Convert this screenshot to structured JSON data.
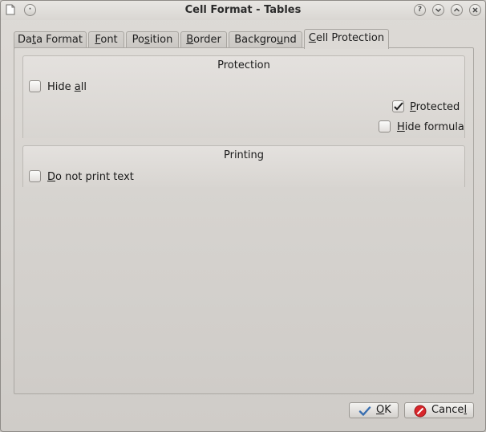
{
  "window": {
    "title": "Cell Format - Tables",
    "controls": [
      "?",
      "v",
      "^",
      "x"
    ]
  },
  "tabs": [
    {
      "pre": "Da",
      "key": "t",
      "post": "a Format",
      "active": false
    },
    {
      "pre": "",
      "key": "F",
      "post": "ont",
      "active": false
    },
    {
      "pre": "Po",
      "key": "s",
      "post": "ition",
      "active": false
    },
    {
      "pre": "",
      "key": "B",
      "post": "order",
      "active": false
    },
    {
      "pre": "Backgro",
      "key": "u",
      "post": "nd",
      "active": false
    },
    {
      "pre": "",
      "key": "C",
      "post": "ell Protection",
      "active": true
    }
  ],
  "protection": {
    "title": "Protection",
    "hide_all": {
      "pre": "Hide ",
      "key": "a",
      "post": "ll",
      "checked": false
    },
    "protected": {
      "pre": "",
      "key": "P",
      "post": "rotected",
      "checked": true
    },
    "hide_formula": {
      "pre": "",
      "key": "H",
      "post": "ide formula",
      "checked": false
    }
  },
  "printing": {
    "title": "Printing",
    "do_not_print": {
      "pre": "",
      "key": "D",
      "post": "o not print text",
      "checked": false
    }
  },
  "buttons": {
    "ok": {
      "pre": "",
      "key": "O",
      "post": "K"
    },
    "cancel": {
      "pre": "Cance",
      "key": "l",
      "post": ""
    }
  },
  "colors": {
    "ok_check": "#3a6fb0",
    "cancel_icon": "#d8262b"
  },
  "icons": {
    "window": "document-icon",
    "ok": "check-icon",
    "cancel": "cancel-icon"
  }
}
